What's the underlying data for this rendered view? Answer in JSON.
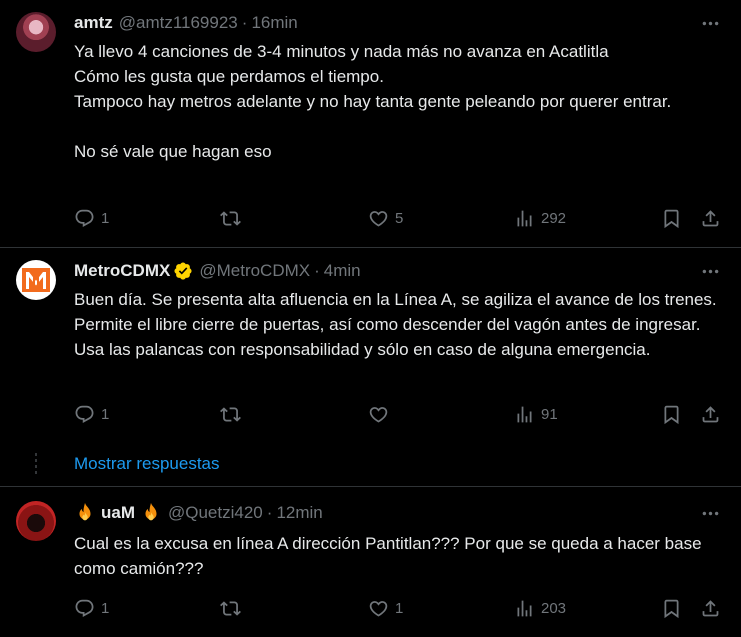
{
  "tweets": [
    {
      "name": "amtz",
      "handle": "@amtz1169923",
      "sep": "·",
      "time": "16min",
      "text": "Ya llevo 4 canciones de 3-4 minutos y nada más no avanza en Acatlitla\nCómo les gusta que perdamos el tiempo.\nTampoco hay metros adelante y no hay tanta gente peleando por querer entrar.\n\nNo sé vale que hagan eso",
      "replies": "1",
      "retweets": "",
      "likes": "5",
      "views": "292"
    },
    {
      "name": "MetroCDMX",
      "handle": "@MetroCDMX",
      "sep": "·",
      "time": "4min",
      "text": "Buen día. Se presenta alta afluencia en la Línea A, se agiliza el avance de los trenes. Permite el libre cierre de puertas, así como descender del vagón antes de ingresar. Usa las palancas con responsabilidad y sólo en caso de alguna emergencia.",
      "replies": "1",
      "retweets": "",
      "likes": "",
      "views": "91"
    },
    {
      "name": "uaM",
      "handle": "@Quetzi420",
      "sep": "·",
      "time": "12min",
      "text": "Cual es la excusa en línea A dirección Pantitlan??? Por que se queda a hacer base como camión???",
      "replies": "1",
      "retweets": "",
      "likes": "1",
      "views": "203"
    }
  ],
  "show_replies": "Mostrar respuestas",
  "colors": {
    "accent": "#1d9bf0",
    "verified": "#ffd400",
    "muted": "#71767b"
  },
  "icons": [
    "more-icon",
    "reply-icon",
    "retweet-icon",
    "like-icon",
    "views-icon",
    "bookmark-icon",
    "share-icon",
    "verified-badge-icon",
    "fire-emoji-icon"
  ]
}
